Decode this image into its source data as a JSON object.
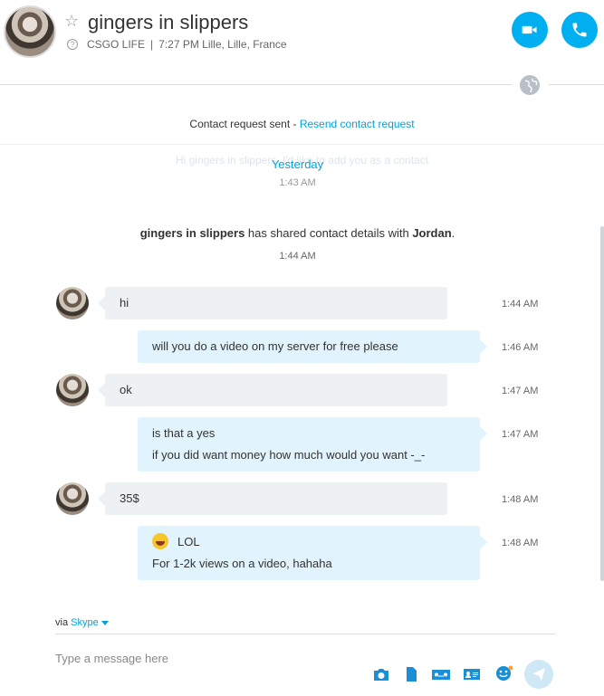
{
  "header": {
    "contact_name": "gingers in slippers",
    "mood": "CSGO LIFE",
    "separator": "|",
    "local_time": "7:27 PM Lille, Lille, France"
  },
  "notice": {
    "text": "Contact request sent - ",
    "link": "Resend contact request"
  },
  "history": {
    "ghost_text": "Hi gingers in slippers, I'd like to add you as a contact",
    "day_label": "Yesterday",
    "ghost_time": "1:43 AM"
  },
  "event": {
    "actor": "gingers in slippers",
    "action": " has shared contact details with ",
    "target": "Jordan",
    "end": ".",
    "time": "1:44 AM"
  },
  "messages": [
    {
      "direction": "in",
      "lines": [
        "hi"
      ],
      "time": "1:44 AM"
    },
    {
      "direction": "out",
      "lines": [
        "will you do a video on my server for free please"
      ],
      "time": "1:46 AM"
    },
    {
      "direction": "in",
      "lines": [
        "ok"
      ],
      "time": "1:47 AM"
    },
    {
      "direction": "out",
      "lines": [
        "is that a yes",
        "if you did want money how much would you want -_-"
      ],
      "time": "1:47 AM"
    },
    {
      "direction": "in",
      "lines": [
        "35$"
      ],
      "time": "1:48 AM"
    },
    {
      "direction": "out",
      "lines": [
        "LOL",
        "For 1-2k views on a video, hahaha"
      ],
      "time": "1:48 AM",
      "emoji": "laughing-emoji"
    }
  ],
  "compose": {
    "via_prefix": "via ",
    "via_service": "Skype",
    "placeholder": "Type a message here"
  },
  "icons": {
    "favorite": "star-icon",
    "help": "help-icon",
    "video_call": "video-camera-icon",
    "audio_call": "phone-icon",
    "globe": "globe-icon",
    "tools": [
      "image-icon",
      "file-icon",
      "video-message-icon",
      "contact-card-icon",
      "emoticon-icon"
    ],
    "send": "send-icon"
  },
  "colors": {
    "accent": "#00aff0",
    "link": "#00a3d9",
    "incoming_bubble": "#eef1f4",
    "outgoing_bubble": "#e1f3fc"
  }
}
